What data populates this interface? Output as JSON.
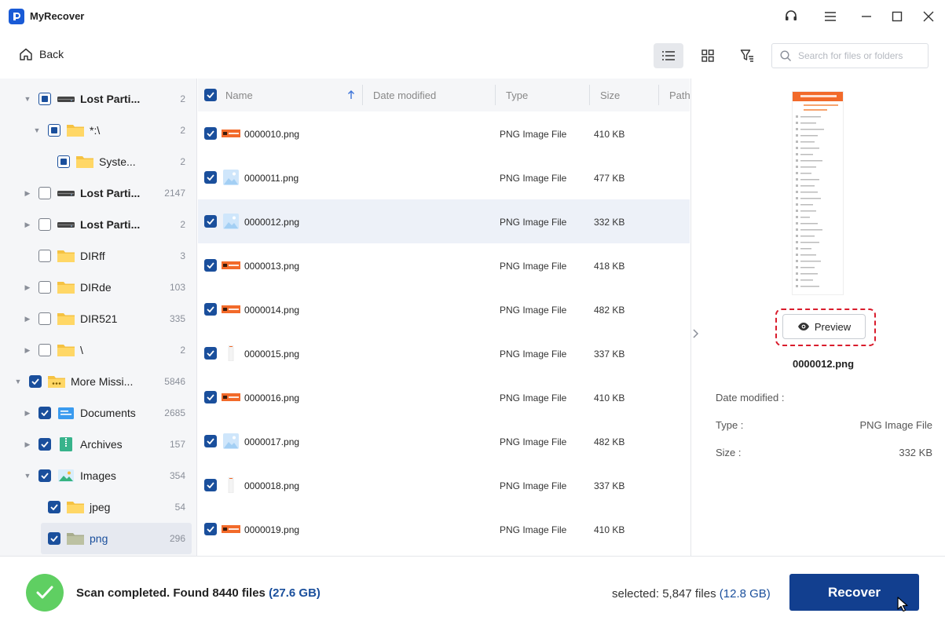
{
  "app": {
    "title": "MyRecover"
  },
  "toolbar": {
    "back_label": "Back",
    "search_placeholder": "Search for files or folders"
  },
  "tree": [
    {
      "label": "Lost Parti...",
      "count": "2",
      "bold": true,
      "icon": "drive-icon",
      "state": "partial",
      "arrow": "down",
      "indent": 0
    },
    {
      "label": "*:\\",
      "count": "2",
      "bold": false,
      "icon": "folder-icon",
      "state": "partial",
      "arrow": "down",
      "indent": 1
    },
    {
      "label": "Syste...",
      "count": "2",
      "bold": false,
      "icon": "folder-icon",
      "state": "partial",
      "arrow": "none",
      "indent": 2
    },
    {
      "label": "Lost Parti...",
      "count": "2147",
      "bold": true,
      "icon": "drive-icon",
      "state": "unchecked",
      "arrow": "right",
      "indent": 0
    },
    {
      "label": "Lost Parti...",
      "count": "2",
      "bold": true,
      "icon": "drive-icon",
      "state": "unchecked",
      "arrow": "right",
      "indent": 0
    },
    {
      "label": "DIRff",
      "count": "3",
      "bold": false,
      "icon": "folder-icon",
      "state": "unchecked",
      "arrow": "none",
      "indent": 0
    },
    {
      "label": "DIRde",
      "count": "103",
      "bold": false,
      "icon": "folder-icon",
      "state": "unchecked",
      "arrow": "right",
      "indent": 0
    },
    {
      "label": "DIR521",
      "count": "335",
      "bold": false,
      "icon": "folder-icon",
      "state": "unchecked",
      "arrow": "right",
      "indent": 0
    },
    {
      "label": "\\",
      "count": "2",
      "bold": false,
      "icon": "folder-icon",
      "state": "unchecked",
      "arrow": "right",
      "indent": 0
    },
    {
      "label": "More Missi...",
      "count": "5846",
      "bold": false,
      "icon": "folder-more-icon",
      "state": "checked",
      "arrow": "down",
      "indent": -1
    },
    {
      "label": "Documents",
      "count": "2685",
      "bold": false,
      "icon": "documents-icon",
      "state": "checked",
      "arrow": "right",
      "indent": 0
    },
    {
      "label": "Archives",
      "count": "157",
      "bold": false,
      "icon": "archives-icon",
      "state": "checked",
      "arrow": "right",
      "indent": 0
    },
    {
      "label": "Images",
      "count": "354",
      "bold": false,
      "icon": "images-icon",
      "state": "checked",
      "arrow": "down",
      "indent": 0
    },
    {
      "label": "jpeg",
      "count": "54",
      "bold": false,
      "icon": "folder-icon",
      "state": "checked",
      "arrow": "none",
      "indent": 1
    },
    {
      "label": "png",
      "count": "296",
      "bold": false,
      "icon": "folder-gray-icon",
      "state": "checked",
      "arrow": "none",
      "indent": 1,
      "selected": true
    }
  ],
  "list": {
    "columns": [
      "Name",
      "Date modified",
      "Type",
      "Size",
      "Path"
    ],
    "files": [
      {
        "name": "0000010.png",
        "type": "PNG Image File",
        "size": "410 KB",
        "thumb": "orange"
      },
      {
        "name": "0000011.png",
        "type": "PNG Image File",
        "size": "477 KB",
        "thumb": "image"
      },
      {
        "name": "0000012.png",
        "type": "PNG Image File",
        "size": "332 KB",
        "thumb": "image",
        "highlight": true
      },
      {
        "name": "0000013.png",
        "type": "PNG Image File",
        "size": "418 KB",
        "thumb": "orange"
      },
      {
        "name": "0000014.png",
        "type": "PNG Image File",
        "size": "482 KB",
        "thumb": "orange"
      },
      {
        "name": "0000015.png",
        "type": "PNG Image File",
        "size": "337 KB",
        "thumb": "tall"
      },
      {
        "name": "0000016.png",
        "type": "PNG Image File",
        "size": "410 KB",
        "thumb": "orange"
      },
      {
        "name": "0000017.png",
        "type": "PNG Image File",
        "size": "482 KB",
        "thumb": "image"
      },
      {
        "name": "0000018.png",
        "type": "PNG Image File",
        "size": "337 KB",
        "thumb": "tall"
      },
      {
        "name": "0000019.png",
        "type": "PNG Image File",
        "size": "410 KB",
        "thumb": "orange"
      }
    ]
  },
  "preview": {
    "button_label": "Preview",
    "filename": "0000012.png",
    "date_label": "Date modified :",
    "date_value": "",
    "type_label": "Type :",
    "type_value": "PNG Image File",
    "size_label": "Size :",
    "size_value": "332 KB"
  },
  "status": {
    "scan_prefix": "Scan completed. Found 8440 files",
    "scan_size": "(27.6 GB)",
    "selected_prefix": "selected: 5,847 files",
    "selected_size": "(12.8 GB)",
    "recover_label": "Recover"
  },
  "colors": {
    "accent": "#123f8f",
    "checkbox": "#1a4f9c",
    "success": "#5fcf62",
    "highlight_outline": "#d91c2c"
  }
}
